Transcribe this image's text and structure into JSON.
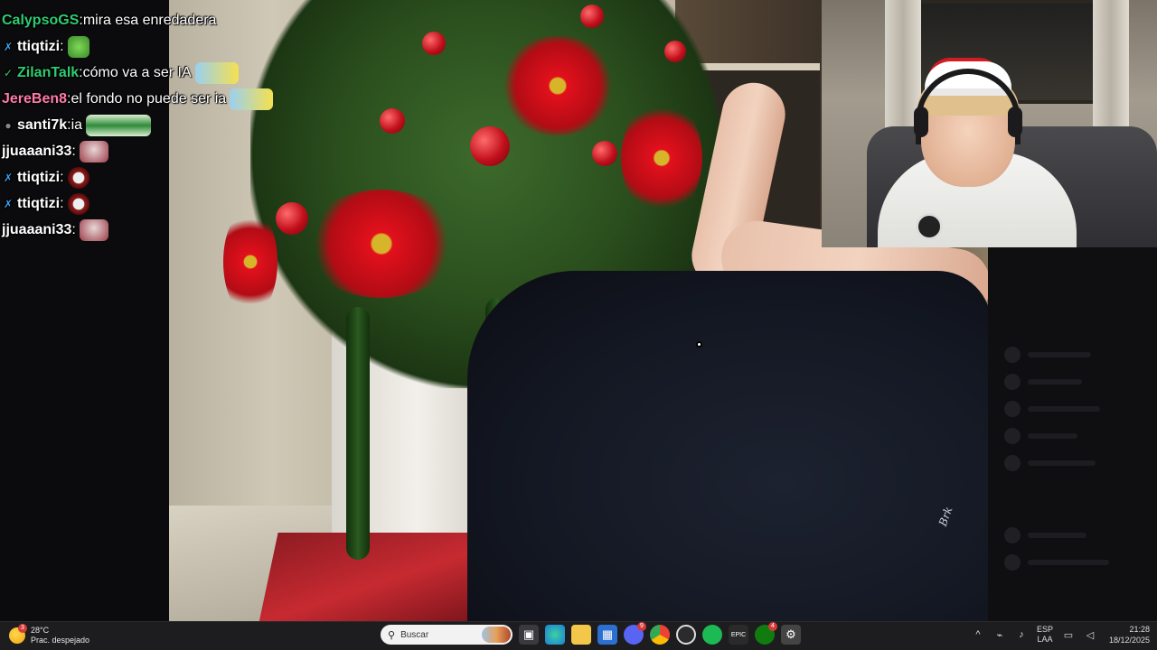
{
  "chat": {
    "messages": [
      {
        "user": "CalypsoGS",
        "user_color": "#2ecc71",
        "badge": "",
        "badge_icon": "none",
        "text": " mira esa enredadera",
        "emote": ""
      },
      {
        "user": "ttiqtizi",
        "user_color": "#ffffff",
        "badge": "✗",
        "badge_icon": "sword-badge-icon",
        "text": "",
        "emote": "pepe-emote"
      },
      {
        "user": "ZilanTalk",
        "user_color": "#2ecc71",
        "badge": "✓",
        "badge_icon": "verified-badge-icon",
        "text": " cómo va a ser IA",
        "emote": "cat-emote"
      },
      {
        "user": "JereBen8",
        "user_color": "#ff7aa8",
        "badge": "",
        "badge_icon": "none",
        "text": " el fondo no puede ser ia",
        "emote": "cat-emote"
      },
      {
        "user": "santi7k",
        "user_color": "#ffffff",
        "badge": "●",
        "badge_icon": "circle-badge-icon",
        "text": " ia",
        "emote": "wide-emote"
      },
      {
        "user": "jjuaaani33",
        "user_color": "#ffffff",
        "badge": "",
        "badge_icon": "none",
        "text": "",
        "emote": "santa-emote"
      },
      {
        "user": "ttiqtizi",
        "user_color": "#ffffff",
        "badge": "✗",
        "badge_icon": "sword-badge-icon",
        "text": "",
        "emote": "ring-emote"
      },
      {
        "user": "ttiqtizi",
        "user_color": "#ffffff",
        "badge": "✗",
        "badge_icon": "sword-badge-icon",
        "text": "",
        "emote": "ring-emote"
      },
      {
        "user": "jjuaaani33",
        "user_color": "#ffffff",
        "badge": "",
        "badge_icon": "none",
        "text": "",
        "emote": "santa-emote"
      }
    ]
  },
  "stream": {
    "pants_logo_text": "Brk",
    "colors": {
      "accent_red": "#d41b22",
      "tree_green": "#2a4e1d"
    }
  },
  "taskbar": {
    "weather_temp": "28°C",
    "weather_desc": "Prac. despejado",
    "weather_badge": "3",
    "search_placeholder": "Buscar",
    "discord_badge": "9",
    "xbox_badge": "4",
    "language_primary": "ESP",
    "language_secondary": "LAA",
    "time": "21:28",
    "date": "18/12/2025",
    "apps": [
      "task-view-icon",
      "edge-icon",
      "file-explorer-icon",
      "store-icon",
      "discord-icon",
      "chrome-icon",
      "obs-icon",
      "spotify-icon",
      "epic-games-icon",
      "xbox-icon",
      "settings-icon"
    ]
  }
}
